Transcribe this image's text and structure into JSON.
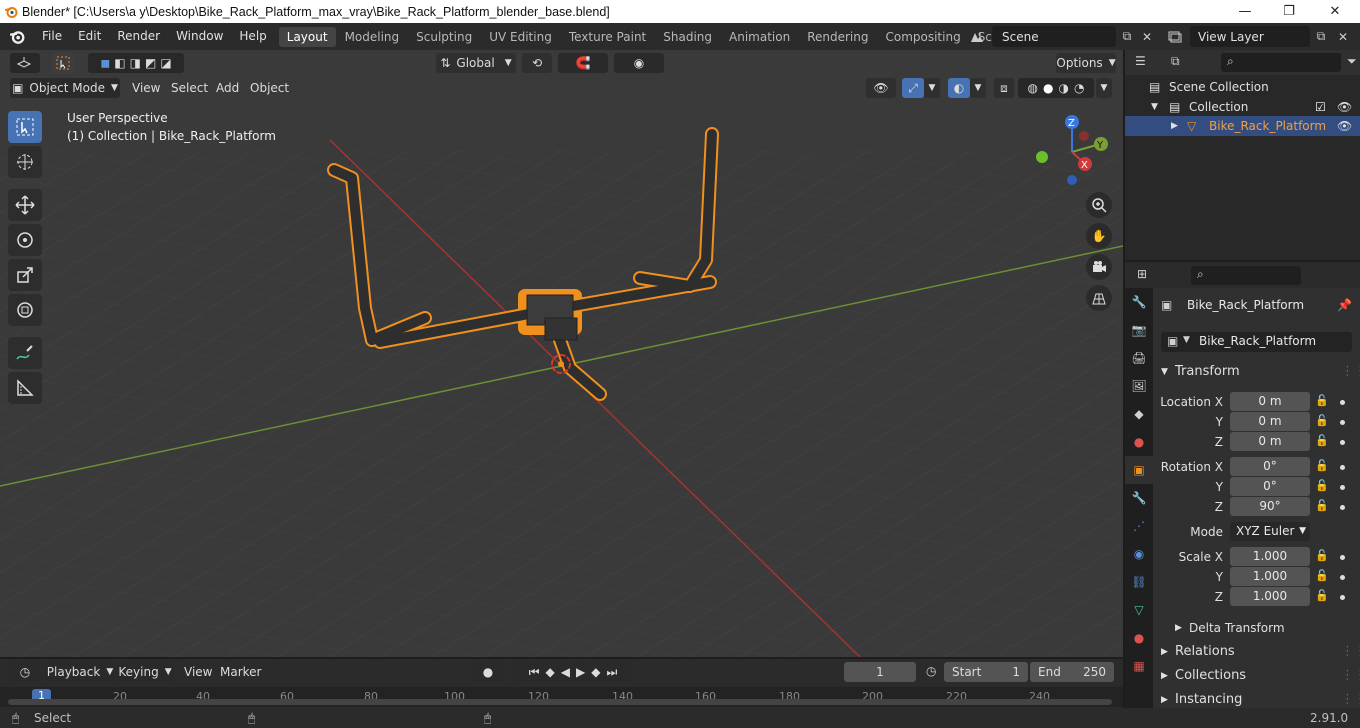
{
  "window": {
    "title": "Blender* [C:\\Users\\a y\\Desktop\\Bike_Rack_Platform_max_vray\\Bike_Rack_Platform_blender_base.blend]",
    "minimize": "—",
    "maximize": "❐",
    "close": "✕"
  },
  "menu": [
    "File",
    "Edit",
    "Render",
    "Window",
    "Help"
  ],
  "workspaces": [
    "Layout",
    "Modeling",
    "Sculpting",
    "UV Editing",
    "Texture Paint",
    "Shading",
    "Animation",
    "Rendering",
    "Compositing",
    "Scripting"
  ],
  "active_workspace": "Layout",
  "add_workspace": "+",
  "scene": "Scene",
  "view_layer": "View Layer",
  "viewport": {
    "mode": "Object Mode",
    "menus": [
      "View",
      "Select",
      "Add",
      "Object"
    ],
    "orientation": "Global",
    "options": "Options",
    "perspective": "User Perspective",
    "collection_info": "(1) Collection | Bike_Rack_Platform",
    "gizmo": {
      "x": "X",
      "y": "Y",
      "z": "Z"
    }
  },
  "outliner": {
    "scene_collection": "Scene Collection",
    "collection": "Collection",
    "object": "Bike_Rack_Platform"
  },
  "properties": {
    "object_name": "Bike_Rack_Platform",
    "data_name": "Bike_Rack_Platform",
    "transform_title": "Transform",
    "location_label": "Location X",
    "rotation_label": "Rotation X",
    "scale_label": "Scale X",
    "y_label": "Y",
    "z_label": "Z",
    "location": {
      "x": "0 m",
      "y": "0 m",
      "z": "0 m"
    },
    "rotation": {
      "x": "0°",
      "y": "0°",
      "z": "90°"
    },
    "mode_label": "Mode",
    "mode_value": "XYZ Euler",
    "scale": {
      "x": "1.000",
      "y": "1.000",
      "z": "1.000"
    },
    "delta_transform": "Delta Transform",
    "relations": "Relations",
    "collections": "Collections",
    "instancing": "Instancing"
  },
  "timeline": {
    "menus": [
      "Playback",
      "Keying",
      "View",
      "Marker"
    ],
    "current_frame": "1",
    "start_label": "Start",
    "start": "1",
    "end_label": "End",
    "end": "250",
    "ruler": [
      "1",
      "20",
      "40",
      "60",
      "80",
      "100",
      "120",
      "140",
      "160",
      "180",
      "200",
      "220",
      "240"
    ]
  },
  "status": {
    "select": "Select",
    "version": "2.91.0"
  },
  "colors": {
    "accent": "#4772b3",
    "selection": "#f0901e",
    "x_axis": "#d13a3a",
    "y_axis": "#7aa033",
    "z_axis": "#3b77e0"
  }
}
